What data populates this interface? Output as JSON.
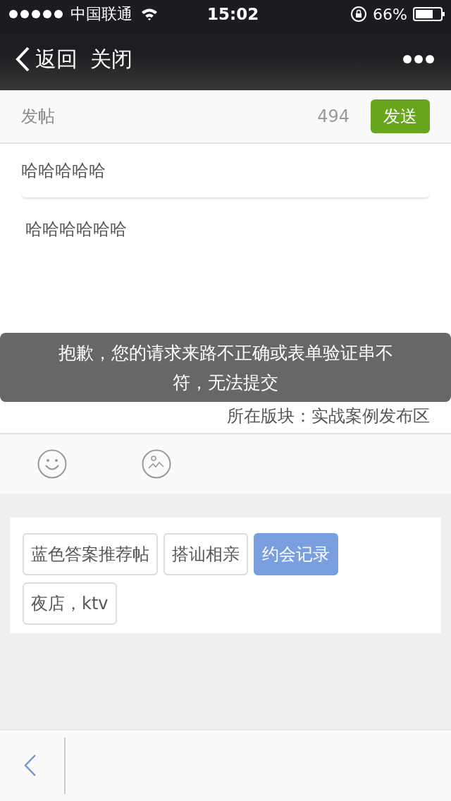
{
  "status_bar": {
    "carrier": "中国联通",
    "time": "15:02",
    "battery_percent": "66%"
  },
  "nav": {
    "back": "返回",
    "close": "关闭"
  },
  "header": {
    "title": "发帖",
    "count": "494",
    "send": "发送"
  },
  "post": {
    "title": "哈哈哈哈哈",
    "body": "哈哈哈哈哈哈",
    "board": "所在版块：实战案例发布区"
  },
  "toast": "抱歉，您的请求来路不正确或表单验证串不符，无法提交",
  "tags": [
    {
      "label": "蓝色答案推荐帖",
      "selected": false
    },
    {
      "label": "搭讪相亲",
      "selected": false
    },
    {
      "label": "约会记录",
      "selected": true
    },
    {
      "label": "夜店，ktv",
      "selected": false
    }
  ]
}
